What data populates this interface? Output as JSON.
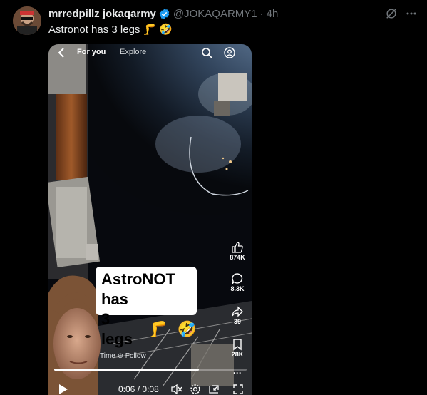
{
  "tweet": {
    "display_name": "mrredpillz jokaqarmy",
    "handle": "@JOKAQARMY1",
    "separator": "·",
    "time": "4h",
    "text": "Astronot has 3 legs",
    "text_emojis": [
      "🦵",
      "🤣"
    ],
    "verified_color": "#1d9bf0"
  },
  "video": {
    "nav": {
      "for_you": "For you",
      "explore": "Explore"
    },
    "caption_line1": "AstroNOT has",
    "caption_line2": "3 legs",
    "caption_emojis": [
      "🦵",
      "🤣"
    ],
    "likes": "874K",
    "comments": "8.3K",
    "shares": "39",
    "saves": "28K",
    "bottom_text": "Time ⊕ Follow",
    "time_current": "0:06",
    "time_total": "0:08",
    "time_separator": "/",
    "progress": 0.75
  }
}
